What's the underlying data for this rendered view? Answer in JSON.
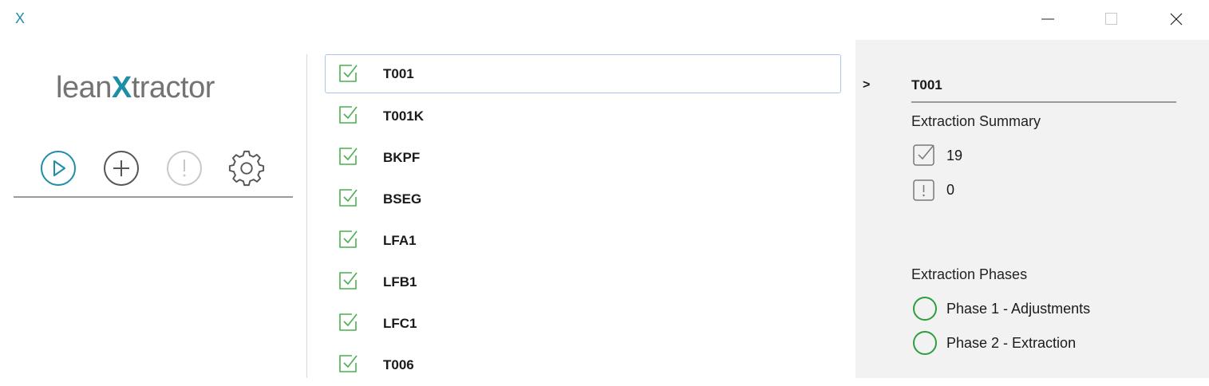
{
  "titlebar": {
    "app_mark": "X",
    "min_icon": "minimize-icon",
    "max_icon": "maximize-icon",
    "close_icon": "close-icon"
  },
  "logo": {
    "part1": "lean",
    "part2": "X",
    "part3": "tractor"
  },
  "toolbar": [
    {
      "icon": "play-icon",
      "color": "#1e8ea8"
    },
    {
      "icon": "plus-icon",
      "color": "#555555"
    },
    {
      "icon": "warning-icon",
      "color": "#c8c8c8"
    },
    {
      "icon": "gear-icon",
      "color": "#555555"
    }
  ],
  "list": {
    "items": [
      {
        "label": "T001",
        "selected": true
      },
      {
        "label": "T001K"
      },
      {
        "label": "BKPF"
      },
      {
        "label": "BSEG"
      },
      {
        "label": "LFA1"
      },
      {
        "label": "LFB1"
      },
      {
        "label": "LFC1"
      },
      {
        "label": "T006"
      }
    ]
  },
  "panel": {
    "caret": ">",
    "title": "T001",
    "summary_heading": "Extraction Summary",
    "ok_count": "19",
    "warn_count": "0",
    "phases_heading": "Extraction Phases",
    "phases": [
      {
        "label": "Phase 1 - Adjustments"
      },
      {
        "label": "Phase 2 - Extraction"
      }
    ]
  },
  "colors": {
    "accent": "#1e8ea8",
    "check_green": "#4caf50",
    "phase_green": "#2e9e3e",
    "panel_bg": "#f2f2f2"
  }
}
